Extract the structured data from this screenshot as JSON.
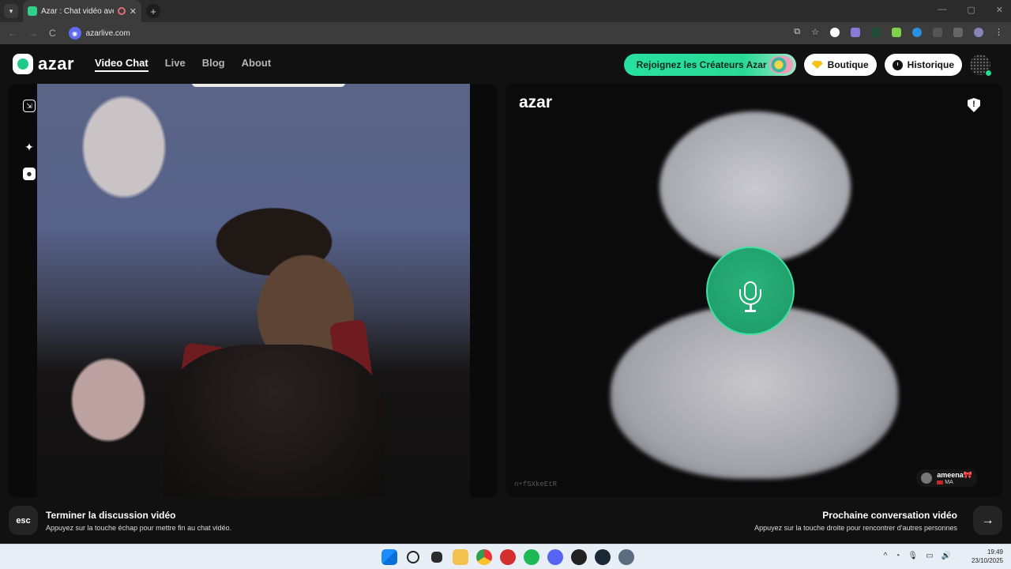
{
  "browser": {
    "tab_title": "Azar : Chat vidéo avec de n",
    "tab_close": "✕",
    "new_tab": "+",
    "url": "azarlive.com",
    "nav_back": "←",
    "nav_forward": "→",
    "nav_reload": "C",
    "win_min": "—",
    "win_max": "▢",
    "win_close": "✕",
    "bookmark_icon": "☆",
    "menu_icon": "⋮"
  },
  "header": {
    "logo_text": "azar",
    "menu": [
      "Video Chat",
      "Live",
      "Blog",
      "About"
    ],
    "creators_label": "Rejoignez les Créateurs Azar",
    "shop_label": "Boutique",
    "history_label": "Historique"
  },
  "right_panel": {
    "logo_text": "azar",
    "shield_symbol": "!",
    "room_id": "n+fSXkeEtR",
    "peer_name": "ameena🎀",
    "peer_country": "MA"
  },
  "bottom": {
    "esc_label": "esc",
    "end_title": "Terminer la discussion vidéo",
    "end_sub": "Appuyez sur la touche échap pour mettre fin au chat vidéo.",
    "next_title": "Prochaine conversation vidéo",
    "next_sub": "Appuyez sur la touche droite pour rencontrer d'autres personnes",
    "next_arrow": "→"
  },
  "taskbar": {
    "time": "19:49",
    "date": "23/10/2025",
    "tray": [
      "^",
      "◔",
      "🎙",
      "▭",
      "🔊"
    ]
  },
  "colors": {
    "accent": "#2bd996",
    "mic": "#20a06c"
  }
}
